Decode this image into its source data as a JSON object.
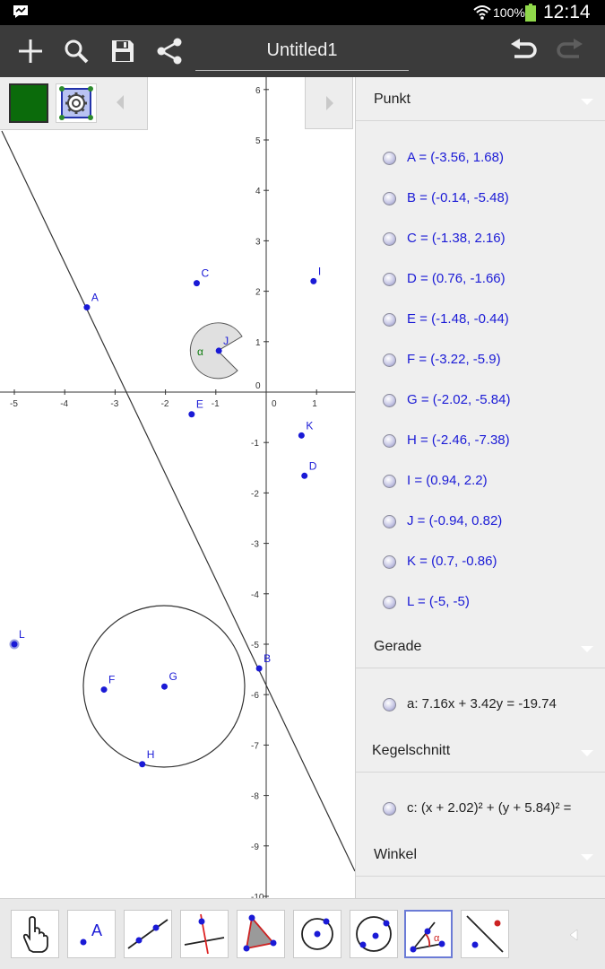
{
  "status": {
    "battery": "100%",
    "time": "12:14"
  },
  "toolbar": {
    "title": "Untitled1"
  },
  "graphics": {
    "x_tick_labels": [
      "-5",
      "-4",
      "-3",
      "-2",
      "-1",
      "0",
      "1"
    ],
    "y_tick_labels": [
      "6",
      "5",
      "4",
      "3",
      "2",
      "1",
      "0",
      "-1",
      "-2",
      "-3",
      "-4",
      "-5",
      "-6",
      "-7",
      "-8",
      "-9",
      "-10"
    ],
    "point_labels": [
      "A",
      "B",
      "C",
      "D",
      "E",
      "F",
      "G",
      "H",
      "I",
      "J",
      "K",
      "L"
    ],
    "angle_label": "α"
  },
  "algebra": {
    "categories": {
      "punkt": "Punkt",
      "gerade": "Gerade",
      "kegelschnitt": "Kegelschnitt",
      "winkel": "Winkel"
    },
    "points": [
      "A = (-3.56, 1.68)",
      "B = (-0.14, -5.48)",
      "C = (-1.38, 2.16)",
      "D = (0.76, -1.66)",
      "E = (-1.48, -0.44)",
      "F = (-3.22, -5.9)",
      "G = (-2.02, -5.84)",
      "H = (-2.46, -7.38)",
      "I = (0.94, 2.2)",
      "J = (-0.94, 0.82)",
      "K = (0.7, -0.86)",
      "L = (-5, -5)"
    ],
    "line": "a: 7.16x + 3.42y = -19.74",
    "conic": "c: (x + 2.02)² + (y + 5.84)² ="
  },
  "icons": {
    "toolbar": [
      "add-icon",
      "search-icon",
      "save-icon",
      "share-icon",
      "undo-icon",
      "redo-icon"
    ],
    "tools": [
      "move-tool-icon",
      "point-tool-icon",
      "line-tool-icon",
      "perpendicular-tool-icon",
      "polygon-tool-icon",
      "circle-center-tool-icon",
      "circle-three-points-tool-icon",
      "angle-tool-icon",
      "reflect-tool-icon"
    ]
  },
  "colors": {
    "point": "#1a1ad6",
    "toolbar": "#3b3b3b",
    "color_button": "#0b6b0b",
    "angle_label": "#0b7a0b"
  }
}
